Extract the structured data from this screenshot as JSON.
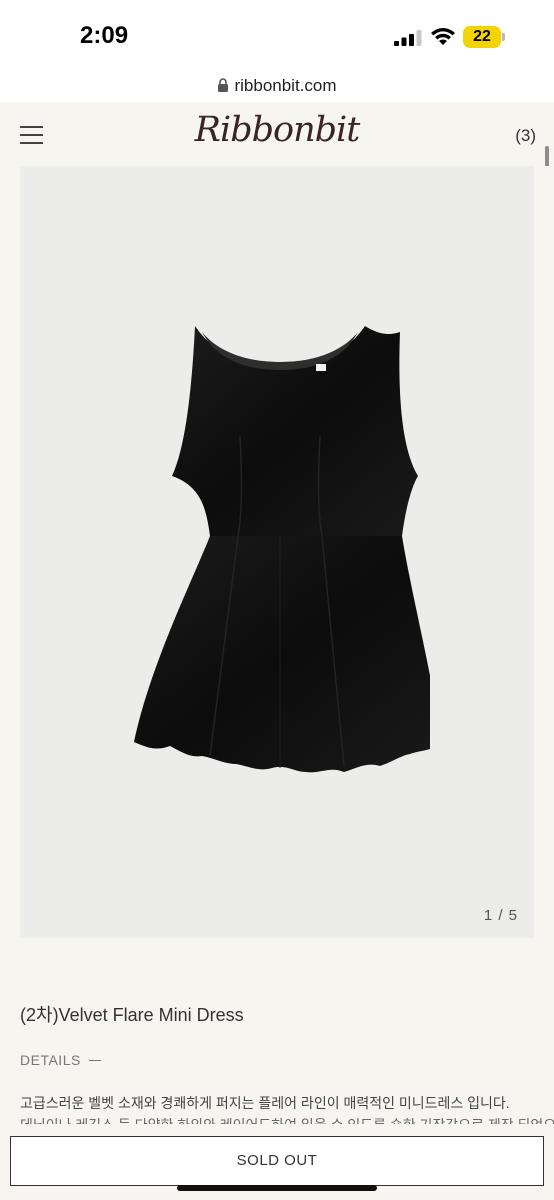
{
  "status": {
    "time": "2:09",
    "battery": "22"
  },
  "browser": {
    "url": "ribbonbit.com"
  },
  "header": {
    "logo": "Ribbonbit",
    "cart_count": "(3)"
  },
  "product": {
    "image_counter": "1 / 5",
    "name": "(2차)Velvet Flare Mini Dress",
    "details_label": "DETAILS",
    "description_line1": "고급스러운 벨벳 소재와 경쾌하게 퍼지는 플레어 라인이 매력적인 미니드레스 입니다.",
    "description_line2": "데님이나 레깅스 등 다양한 하의와 레이어드하여 입을 수 있도록 숏한 기장감으로 제작 되었으"
  },
  "actions": {
    "sold_out_label": "SOLD OUT"
  }
}
